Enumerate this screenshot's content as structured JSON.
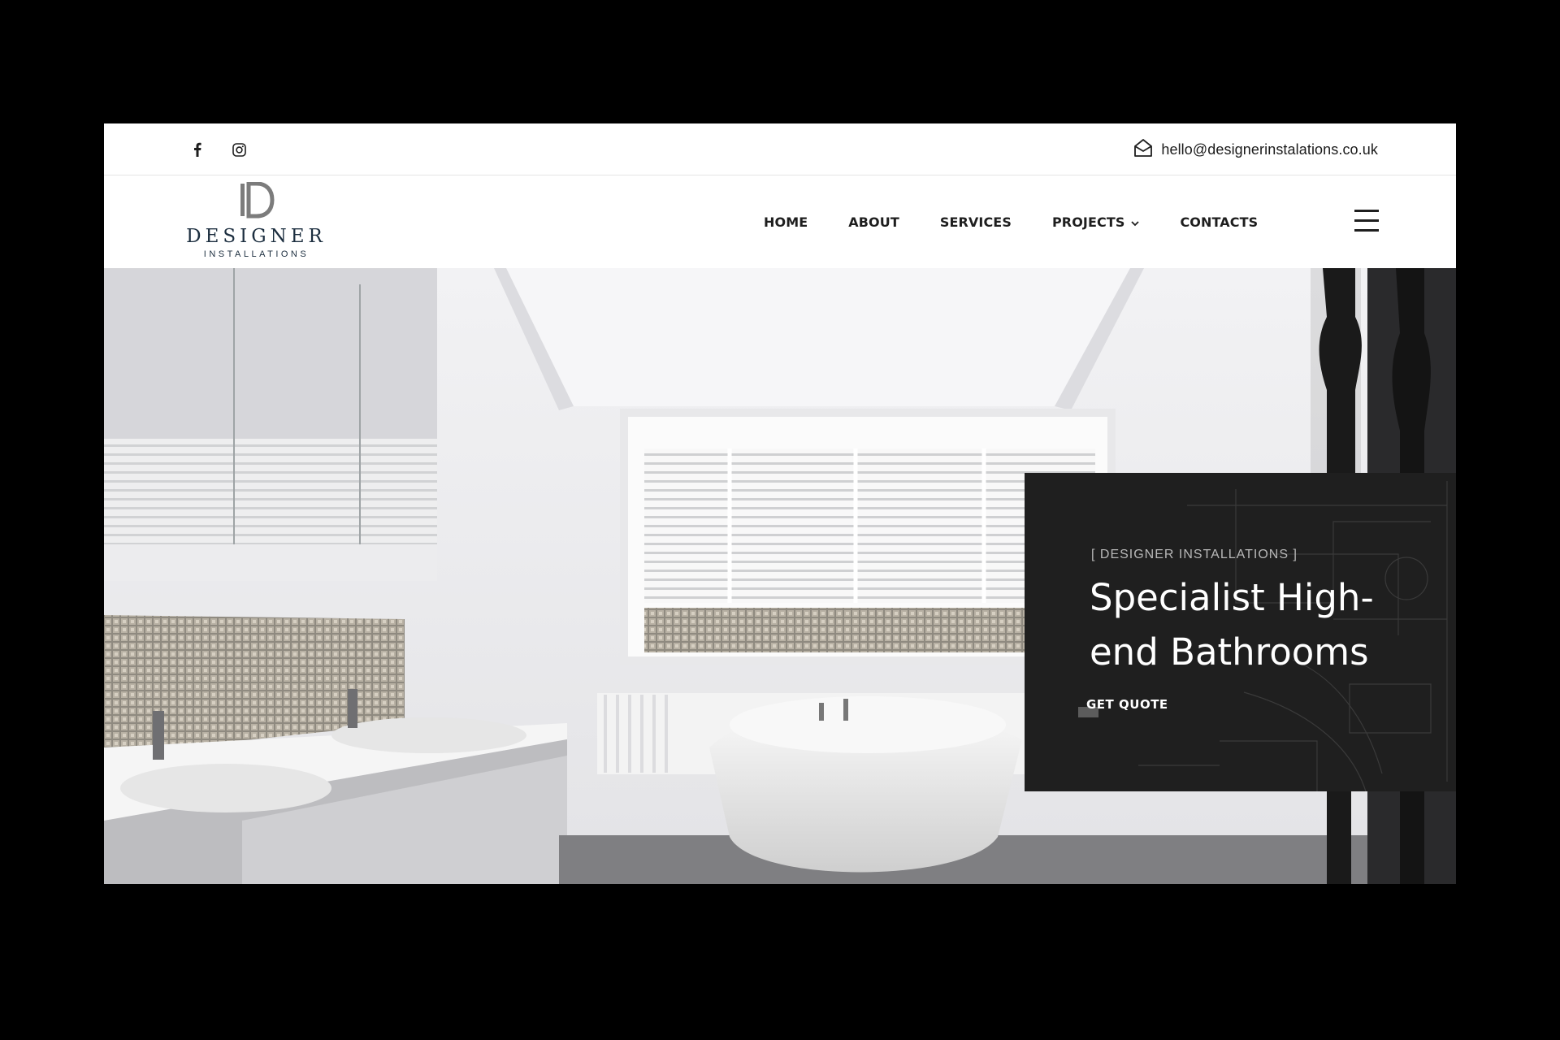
{
  "topbar": {
    "social": [
      {
        "icon": "facebook-icon"
      },
      {
        "icon": "instagram-icon"
      }
    ],
    "email_icon": "envelope-icon",
    "email": "hello@designerinstalations.co.uk"
  },
  "brand": {
    "logo_icon": "d-monogram-logo",
    "name": "DESIGNER",
    "sub": "INSTALLATIONS"
  },
  "nav": {
    "items": [
      {
        "label": "HOME"
      },
      {
        "label": "ABOUT"
      },
      {
        "label": "SERVICES"
      },
      {
        "label": "PROJECTS",
        "dropdown": true
      },
      {
        "label": "CONTACTS"
      }
    ],
    "menu_icon": "hamburger-icon"
  },
  "hero": {
    "eyebrow": "[ DESIGNER INSTALLATIONS ]",
    "title": "Specialist High-end Bathrooms",
    "cta": "GET QUOTE"
  },
  "colors": {
    "card_bg": "#1f1f1f",
    "brand_navy": "#1c2e3f",
    "frame_bg": "#000000"
  }
}
